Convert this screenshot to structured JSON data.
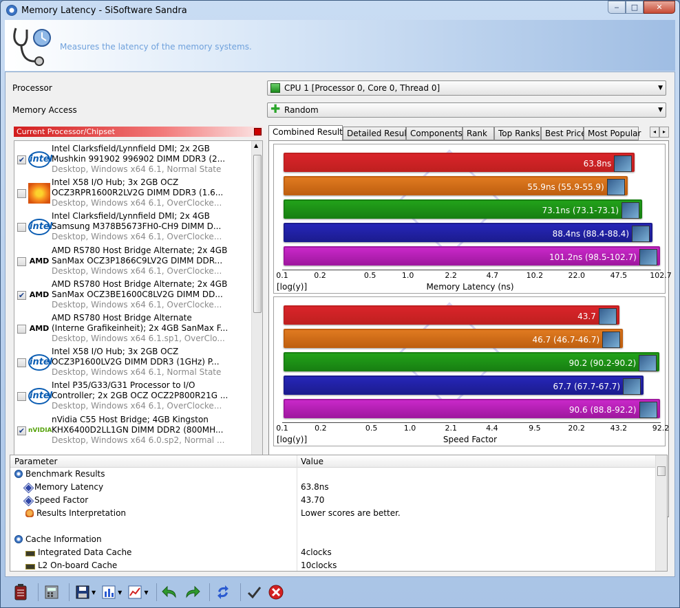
{
  "window": {
    "title": "Memory Latency - SiSoftware Sandra",
    "description": "Measures the latency of the memory systems.",
    "controls": {
      "minimize": "‒",
      "maximize": "□",
      "close": "✕"
    }
  },
  "form": {
    "processor_label": "Processor",
    "processor_value": "CPU 1 [Processor 0, Core 0, Thread 0]",
    "memory_access_label": "Memory Access",
    "memory_access_value": "Random"
  },
  "list": {
    "header": "Current Processor/Chipset",
    "items": [
      {
        "brand": "intel",
        "checked": true,
        "line1": "Intel Clarksfield/Lynnfield DMI; 2x 2GB",
        "line2": "Mushkin 991902 996902 DIMM DDR3 (2...",
        "line3": "Desktop, Windows x64 6.1, Normal State"
      },
      {
        "brand": "sun",
        "checked": false,
        "line1": "Intel X58 I/O Hub; 3x 2GB OCZ",
        "line2": "OCZ3RPR1600R2LV2G DIMM DDR3 (1.6...",
        "line3": "Desktop, Windows x64 6.1, OverClocke..."
      },
      {
        "brand": "intel",
        "checked": false,
        "line1": "Intel Clarksfield/Lynnfield DMI; 2x 4GB",
        "line2": "Samsung M378B5673FH0-CH9 DIMM D...",
        "line3": "Desktop, Windows x64 6.1, OverClocke..."
      },
      {
        "brand": "amd",
        "checked": false,
        "line1": "AMD RS780 Host Bridge Alternate; 2x 4GB",
        "line2": "SanMax OCZ3P1866C9LV2G DIMM DDR...",
        "line3": "Desktop, Windows x64 6.1, OverClocke..."
      },
      {
        "brand": "amd",
        "checked": true,
        "line1": "AMD RS780 Host Bridge Alternate; 2x 4GB",
        "line2": "SanMax OCZ3BE1600C8LV2G DIMM DD...",
        "line3": "Desktop, Windows x64 6.1, OverClocke..."
      },
      {
        "brand": "amd",
        "checked": false,
        "line1": "AMD RS780 Host Bridge Alternate",
        "line2": "(Interne Grafikeinheit); 2x 4GB SanMax F...",
        "line3": "Desktop, Windows x64 6.1.sp1, OverClo..."
      },
      {
        "brand": "intel",
        "checked": false,
        "line1": "Intel X58 I/O Hub; 3x 2GB OCZ",
        "line2": "OCZ3P1600LV2G DIMM DDR3 (1GHz) P...",
        "line3": "Desktop, Windows x64 6.1, Normal State"
      },
      {
        "brand": "intel",
        "checked": false,
        "line1": "Intel P35/G33/G31 Processor to I/O",
        "line2": "Controller; 2x 2GB OCZ OCZ2P800R21G ...",
        "line3": "Desktop, Windows x64 6.1, OverClocke..."
      },
      {
        "brand": "nvidia",
        "checked": true,
        "line1": "nVidia C55 Host Bridge; 4GB Kingston",
        "line2": "KHX6400D2LL1GN DIMM DDR2 (800MH...",
        "line3": "Desktop, Windows x64 6.0.sp2, Normal ..."
      }
    ],
    "brand_text": {
      "intel": "intel",
      "amd": "AMD",
      "nvidia": "nVIDIA",
      "sun": ""
    }
  },
  "tabs": [
    "Combined Results",
    "Detailed Results",
    "Components",
    "Rank",
    "Top Ranks",
    "Best Price",
    "Most Popular"
  ],
  "tab_arrows": {
    "left": "◂",
    "right": "▸"
  },
  "watermark_tm": "TM",
  "chart_data": [
    {
      "type": "bar",
      "orientation": "horizontal",
      "xscale": "log",
      "xlabel": "Memory Latency (ns)",
      "ylabel": "[log(y)]",
      "ticks": [
        "0.1",
        "0.2",
        "0.5",
        "1.0",
        "2.2",
        "4.7",
        "10.2",
        "22.0",
        "47.5",
        "102.7"
      ],
      "xlim": [
        0.1,
        102.7
      ],
      "series": [
        {
          "value": 63.8,
          "label": "63.8ns",
          "color": "#d9242a",
          "edge": "#c02020"
        },
        {
          "value": 55.9,
          "label": "55.9ns (55.9-55.9)",
          "color": "#e07a20",
          "edge": "#c06010"
        },
        {
          "value": 73.1,
          "label": "73.1ns (73.1-73.1)",
          "color": "#22a21a",
          "edge": "#188012"
        },
        {
          "value": 88.4,
          "label": "88.4ns (88.4-88.4)",
          "color": "#2626b8",
          "edge": "#1c1c90"
        },
        {
          "value": 101.2,
          "label": "101.2ns (98.5-102.7)",
          "color": "#c928c9",
          "edge": "#a018a0"
        }
      ]
    },
    {
      "type": "bar",
      "orientation": "horizontal",
      "xscale": "log",
      "xlabel": "Speed Factor",
      "ylabel": "[log(y)]",
      "ticks": [
        "0.1",
        "0.2",
        "0.5",
        "1.0",
        "2.1",
        "4.4",
        "9.5",
        "20.2",
        "43.2",
        "92.2"
      ],
      "xlim": [
        0.1,
        92.2
      ],
      "series": [
        {
          "value": 43.7,
          "label": "43.7",
          "color": "#d9242a",
          "edge": "#c02020"
        },
        {
          "value": 46.7,
          "label": "46.7 (46.7-46.7)",
          "color": "#e07a20",
          "edge": "#c06010"
        },
        {
          "value": 90.2,
          "label": "90.2 (90.2-90.2)",
          "color": "#22a21a",
          "edge": "#188012"
        },
        {
          "value": 67.7,
          "label": "67.7 (67.7-67.7)",
          "color": "#2626b8",
          "edge": "#1c1c90"
        },
        {
          "value": 90.6,
          "label": "90.6 (88.8-92.2)",
          "color": "#c928c9",
          "edge": "#a018a0"
        }
      ]
    }
  ],
  "grid": {
    "col_parameter": "Parameter",
    "col_value": "Value",
    "rows": [
      {
        "indent": 0,
        "icon": "bench",
        "param": "Benchmark Results",
        "value": ""
      },
      {
        "indent": 1,
        "icon": "dia",
        "param": "Memory Latency",
        "value": "63.8ns"
      },
      {
        "indent": 1,
        "icon": "dia",
        "param": "Speed Factor",
        "value": "43.70"
      },
      {
        "indent": 1,
        "icon": "bulb",
        "param": "Results Interpretation",
        "value": "Lower scores are better."
      },
      {
        "indent": 0,
        "icon": "",
        "param": "",
        "value": ""
      },
      {
        "indent": 0,
        "icon": "bench",
        "param": "Cache Information",
        "value": ""
      },
      {
        "indent": 1,
        "icon": "chip",
        "param": "Integrated Data Cache",
        "value": "4clocks"
      },
      {
        "indent": 1,
        "icon": "chip",
        "param": "L2 On-board Cache",
        "value": "10clocks"
      }
    ]
  },
  "toolbar": {
    "items": [
      "battery-icon",
      "calculator-icon",
      "save-icon",
      "chart-icon",
      "graph-icon",
      "back-icon",
      "forward-icon",
      "refresh-icon",
      "ok-icon",
      "cancel-icon"
    ]
  }
}
